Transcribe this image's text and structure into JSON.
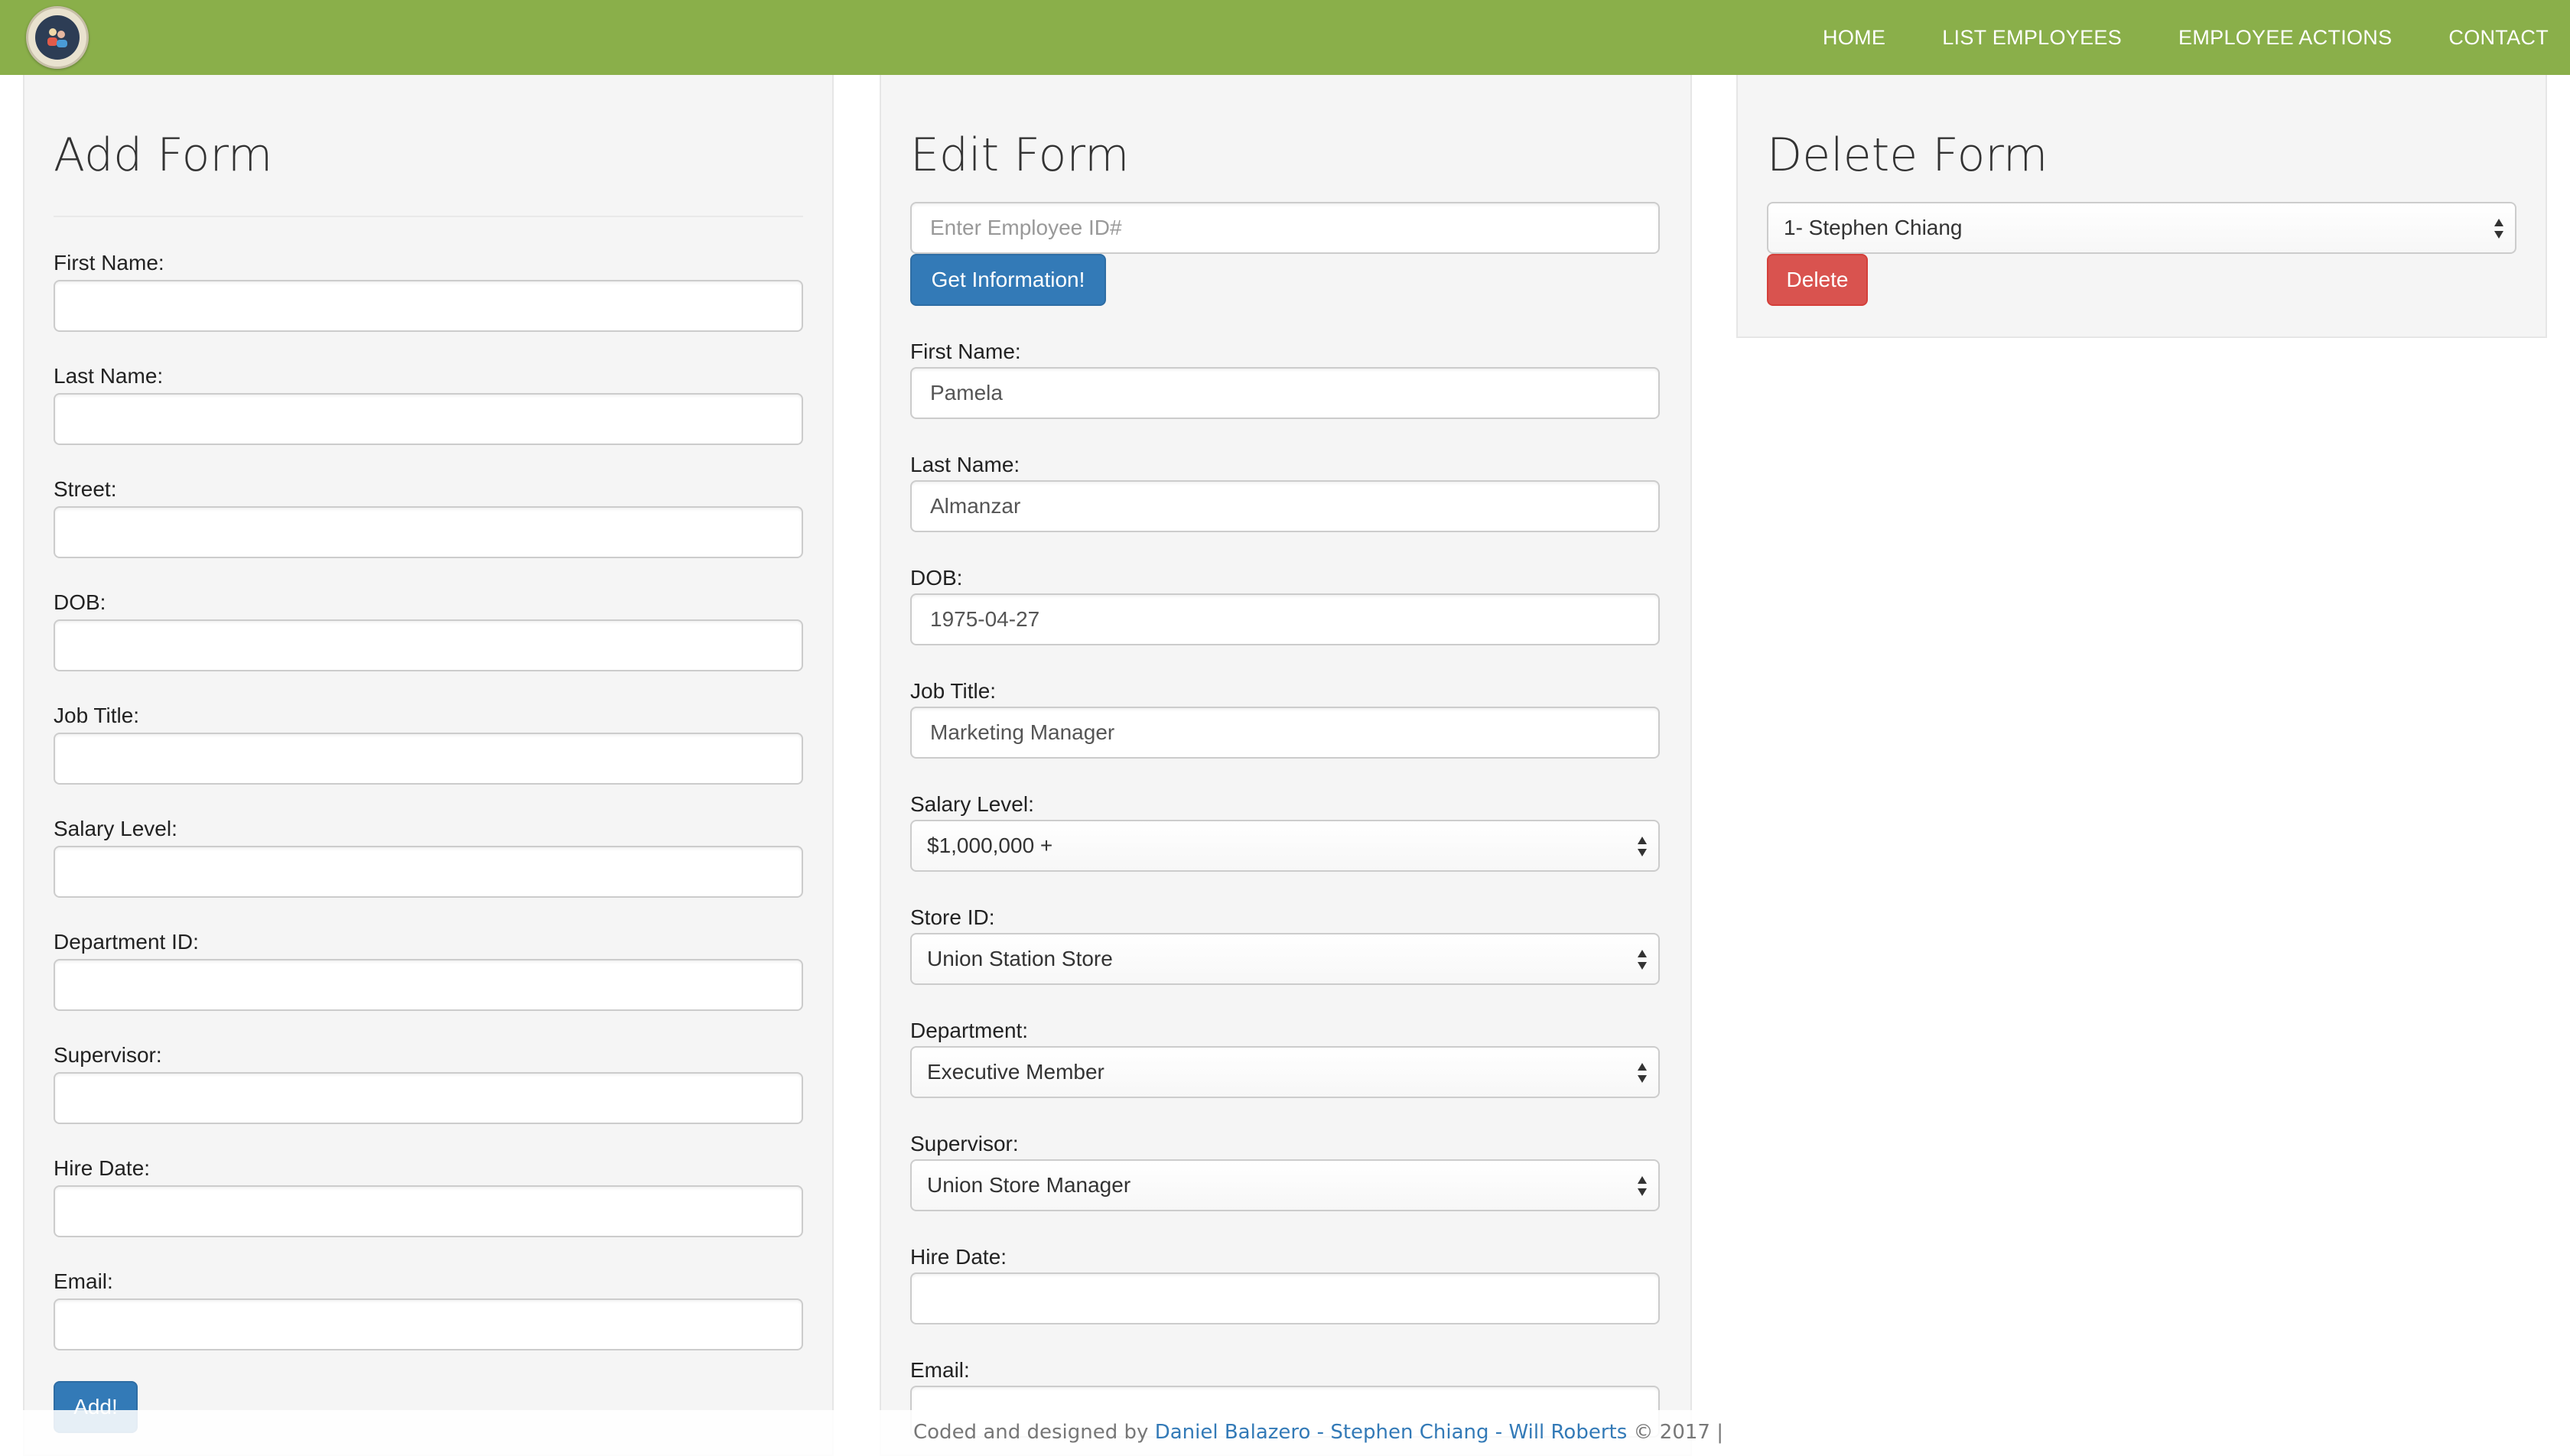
{
  "nav": {
    "logo": "people-logo-icon",
    "links": [
      "HOME",
      "LIST EMPLOYEES",
      "EMPLOYEE ACTIONS",
      "CONTACT"
    ]
  },
  "add_form": {
    "title": "Add Form",
    "labels": {
      "first_name": "First Name:",
      "last_name": "Last Name:",
      "street": "Street:",
      "dob": "DOB:",
      "job_title": "Job Title:",
      "salary_level": "Salary Level:",
      "department_id": "Department ID:",
      "supervisor": "Supervisor:",
      "hire_date": "Hire Date:",
      "email": "Email:"
    },
    "values": {
      "first_name": "",
      "last_name": "",
      "street": "",
      "dob": "",
      "job_title": "",
      "salary_level": "",
      "department_id": "",
      "supervisor": "",
      "hire_date": "",
      "email": ""
    },
    "submit_label": "Add!"
  },
  "edit_form": {
    "title": "Edit Form",
    "id_placeholder": "Enter Employee ID#",
    "id_value": "",
    "get_info_label": "Get Information!",
    "labels": {
      "first_name": "First Name:",
      "last_name": "Last Name:",
      "dob": "DOB:",
      "job_title": "Job Title:",
      "salary_level": "Salary Level:",
      "store_id": "Store ID:",
      "department": "Department:",
      "supervisor": "Supervisor:",
      "hire_date": "Hire Date:",
      "email": "Email:"
    },
    "values": {
      "first_name": "Pamela",
      "last_name": "Almanzar",
      "dob": "1975-04-27",
      "job_title": "Marketing Manager",
      "salary_level": "$1,000,000 +",
      "store_id": "Union Station Store",
      "department": "Executive Member",
      "supervisor": "Union Store Manager",
      "hire_date": "",
      "email": ""
    }
  },
  "delete_form": {
    "title": "Delete Form",
    "selected_employee": "1- Stephen Chiang",
    "delete_label": "Delete"
  },
  "footer": {
    "prefix": "Coded and designed by ",
    "author1": "Daniel Balazero",
    "sep": " - ",
    "author2": "Stephen Chiang",
    "author3": "Will Roberts",
    "suffix": " © 2017  |"
  },
  "colors": {
    "navbar": "#8aaf4a",
    "primary": "#337ab7",
    "danger": "#d9534f",
    "panel": "#f5f5f5"
  }
}
